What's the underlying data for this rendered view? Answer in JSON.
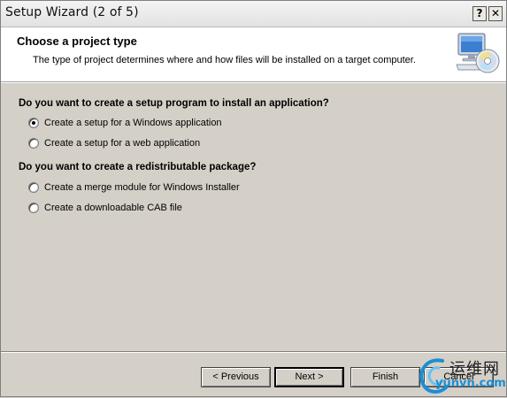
{
  "window": {
    "title": "Setup Wizard (2 of 5)",
    "help_label": "?",
    "close_label": "✕"
  },
  "header": {
    "title": "Choose a project type",
    "subtitle": "The type of project determines where and how files will be installed on a target computer.",
    "icon": "computer-cd-icon"
  },
  "sections": [
    {
      "heading": "Do you want to create a setup program to install an application?",
      "options": [
        {
          "label": "Create a setup for a Windows application",
          "checked": true
        },
        {
          "label": "Create a setup for a web application",
          "checked": false
        }
      ]
    },
    {
      "heading": "Do you want to create a redistributable package?",
      "options": [
        {
          "label": "Create a merge module for Windows Installer",
          "checked": false
        },
        {
          "label": "Create a downloadable CAB file",
          "checked": false
        }
      ]
    }
  ],
  "buttons": {
    "previous": "< Previous",
    "next": "Next >",
    "finish": "Finish",
    "cancel": "Cancel"
  },
  "watermark": {
    "cn_text": "运维网",
    "url": "yunvn.com"
  },
  "colors": {
    "dialog_bg": "#d4d0c8",
    "header_bg": "#ffffff",
    "watermark_blue": "#1a8fd6"
  }
}
